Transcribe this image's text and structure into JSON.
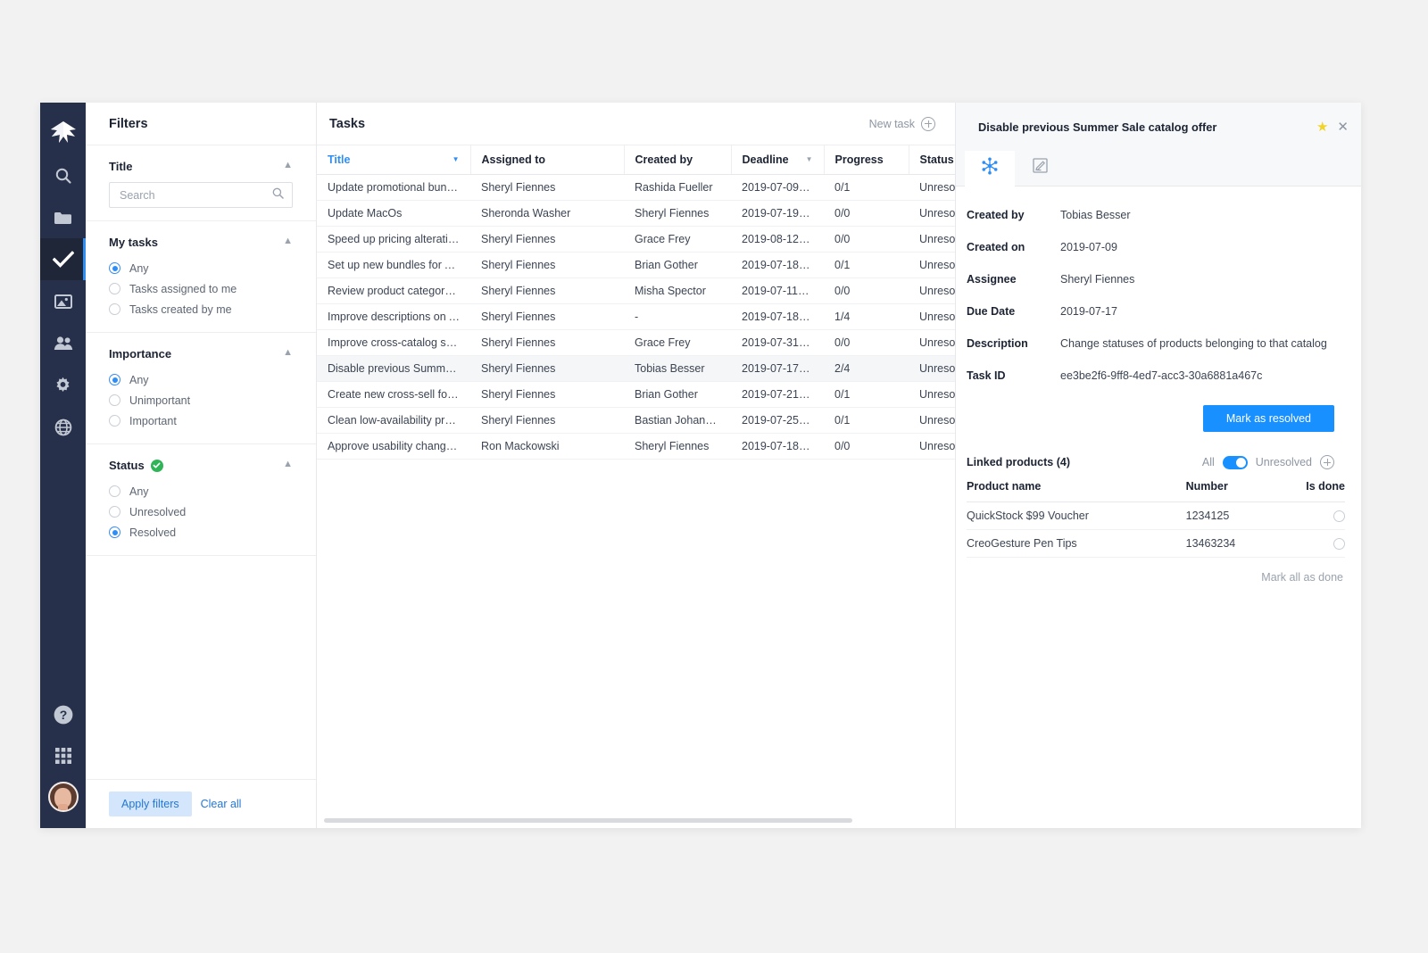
{
  "nav": {
    "logo": "logo-icon",
    "items": [
      {
        "name": "search",
        "icon": "search-icon",
        "active": false
      },
      {
        "name": "folders",
        "icon": "folder-icon",
        "active": false
      },
      {
        "name": "tasks",
        "icon": "check-icon",
        "active": true
      },
      {
        "name": "media",
        "icon": "image-icon",
        "active": false
      },
      {
        "name": "users",
        "icon": "users-icon",
        "active": false
      },
      {
        "name": "settings",
        "icon": "gear-icon",
        "active": false
      },
      {
        "name": "globe",
        "icon": "globe-icon",
        "active": false
      }
    ],
    "bottom": [
      {
        "name": "help",
        "icon": "question-icon"
      },
      {
        "name": "apps",
        "icon": "grid-icon"
      },
      {
        "name": "profile",
        "icon": "avatar"
      }
    ]
  },
  "filters": {
    "header": "Filters",
    "title_group": {
      "label": "Title",
      "search_placeholder": "Search",
      "search_value": "",
      "collapse_icon": "chevron-up-icon"
    },
    "my_tasks": {
      "label": "My tasks",
      "options": [
        {
          "label": "Any",
          "selected": true
        },
        {
          "label": "Tasks assigned to me",
          "selected": false
        },
        {
          "label": "Tasks created by me",
          "selected": false
        }
      ]
    },
    "importance": {
      "label": "Importance",
      "options": [
        {
          "label": "Any",
          "selected": true
        },
        {
          "label": "Unimportant",
          "selected": false
        },
        {
          "label": "Important",
          "selected": false
        }
      ]
    },
    "status": {
      "label": "Status",
      "badge_icon": "green-check-icon",
      "options": [
        {
          "label": "Any",
          "selected": false
        },
        {
          "label": "Unresolved",
          "selected": false
        },
        {
          "label": "Resolved",
          "selected": true
        }
      ]
    },
    "apply_label": "Apply filters",
    "clear_label": "Clear all"
  },
  "tasks": {
    "header_title": "Tasks",
    "new_task_label": "New task",
    "new_task_icon": "plus-circle-icon",
    "columns": [
      {
        "key": "title",
        "label": "Title",
        "sorted": true,
        "caret": "▼"
      },
      {
        "key": "assigned_to",
        "label": "Assigned to",
        "sorted": false,
        "caret": ""
      },
      {
        "key": "created_by",
        "label": "Created by",
        "sorted": false,
        "caret": ""
      },
      {
        "key": "deadline",
        "label": "Deadline",
        "sorted": false,
        "caret": "▼"
      },
      {
        "key": "progress",
        "label": "Progress",
        "sorted": false,
        "caret": ""
      },
      {
        "key": "status",
        "label": "Status",
        "sorted": false,
        "caret": ""
      }
    ],
    "rows": [
      {
        "title": "Update promotional bundle...",
        "assigned_to": "Sheryl Fiennes",
        "created_by": "Rashida Fueller",
        "deadline": "2019-07-09T...",
        "progress": "0/1",
        "status": "Unresolved",
        "selected": false
      },
      {
        "title": "Update MacOs",
        "assigned_to": "Sheronda Washer",
        "created_by": "Sheryl Fiennes",
        "deadline": "2019-07-19T...",
        "progress": "0/0",
        "status": "Unresolved",
        "selected": false
      },
      {
        "title": "Speed up pricing alterations",
        "assigned_to": "Sheryl Fiennes",
        "created_by": "Grace Frey",
        "deadline": "2019-08-12T...",
        "progress": "0/0",
        "status": "Unresolved",
        "selected": false
      },
      {
        "title": "Set up new bundles for Au...",
        "assigned_to": "Sheryl Fiennes",
        "created_by": "Brian Gother",
        "deadline": "2019-07-18T...",
        "progress": "0/1",
        "status": "Unresolved",
        "selected": false
      },
      {
        "title": "Review product category fe...",
        "assigned_to": "Sheryl Fiennes",
        "created_by": "Misha Spector",
        "deadline": "2019-07-11T0...",
        "progress": "0/0",
        "status": "Unresolved",
        "selected": false
      },
      {
        "title": "Improve descriptions on All...",
        "assigned_to": "Sheryl Fiennes",
        "created_by": "-",
        "deadline": "2019-07-18T...",
        "progress": "1/4",
        "status": "Unresolved",
        "selected": false
      },
      {
        "title": "Improve cross-catalog shari...",
        "assigned_to": "Sheryl Fiennes",
        "created_by": "Grace Frey",
        "deadline": "2019-07-31T...",
        "progress": "0/0",
        "status": "Unresolved",
        "selected": false
      },
      {
        "title": "Disable previous Summer S...",
        "assigned_to": "Sheryl Fiennes",
        "created_by": "Tobias Besser",
        "deadline": "2019-07-17T...",
        "progress": "2/4",
        "status": "Unresolved",
        "selected": true
      },
      {
        "title": "Create new cross-sell for A...",
        "assigned_to": "Sheryl Fiennes",
        "created_by": "Brian Gother",
        "deadline": "2019-07-21T...",
        "progress": "0/1",
        "status": "Unresolved",
        "selected": false
      },
      {
        "title": "Clean low-availability produ...",
        "assigned_to": "Sheryl Fiennes",
        "created_by": "Bastian Johannes",
        "deadline": "2019-07-25T...",
        "progress": "0/1",
        "status": "Unresolved",
        "selected": false
      },
      {
        "title": "Approve usability changes i...",
        "assigned_to": "Ron Mackowski",
        "created_by": "Sheryl Fiennes",
        "deadline": "2019-07-18T...",
        "progress": "0/0",
        "status": "Unresolved",
        "selected": false
      }
    ]
  },
  "detail": {
    "title": "Disable previous Summer Sale catalog offer",
    "star_icon": "star-icon",
    "close_icon": "close-icon",
    "tabs": [
      {
        "name": "links",
        "icon": "network-nodes-icon",
        "active": true
      },
      {
        "name": "notes",
        "icon": "edit-note-icon",
        "active": false
      }
    ],
    "fields": [
      {
        "label": "Created by",
        "value": "Tobias Besser"
      },
      {
        "label": "Created on",
        "value": "2019-07-09"
      },
      {
        "label": "Assignee",
        "value": "Sheryl Fiennes"
      },
      {
        "label": "Due Date",
        "value": "2019-07-17"
      },
      {
        "label": "Description",
        "value": "Change statuses of products belonging to that catalog"
      },
      {
        "label": "Task ID",
        "value": "ee3be2f6-9ff8-4ed7-acc3-30a6881a467c"
      }
    ],
    "resolve_label": "Mark as resolved",
    "linked": {
      "title": "Linked products (4)",
      "toggle_left": "All",
      "toggle_right": "Unresolved",
      "toggle_on": true,
      "add_icon": "plus-circle-icon",
      "columns": [
        "Product name",
        "Number",
        "Is done"
      ],
      "rows": [
        {
          "product_name": "QuickStock $99 Voucher",
          "number": "1234125",
          "is_done": false
        },
        {
          "product_name": "CreoGesture Pen Tips",
          "number": "13463234",
          "is_done": false
        }
      ],
      "mark_all_label": "Mark all as done"
    }
  },
  "colors": {
    "accent": "#1890ff",
    "nav_bg": "#27304a",
    "star": "#f2d327",
    "green": "#2fb457"
  }
}
